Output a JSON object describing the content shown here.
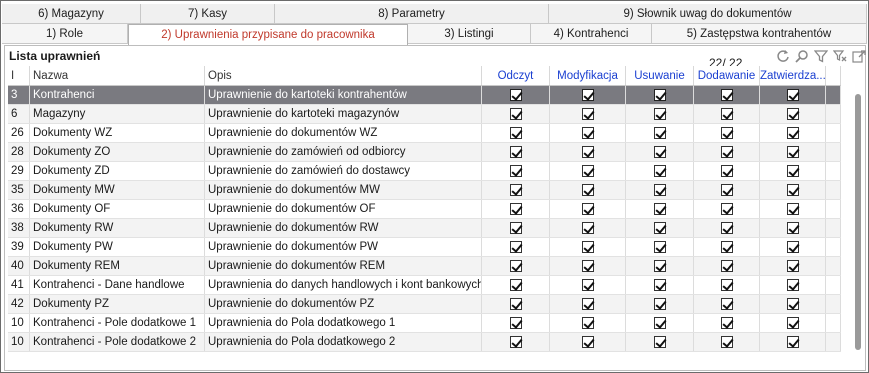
{
  "tabs_row1": [
    {
      "label": "6) Magazyny",
      "active": false
    },
    {
      "label": "7) Kasy",
      "active": false
    },
    {
      "label": "8) Parametry",
      "active": false
    },
    {
      "label": "9) Słownik uwag do dokumentów",
      "active": false
    }
  ],
  "tabs_row2": [
    {
      "label": "1) Role",
      "active": false
    },
    {
      "label": "2) Uprawnienia przypisane do pracownika",
      "active": true
    },
    {
      "label": "3) Listingi",
      "active": false
    },
    {
      "label": "4) Kontrahenci",
      "active": false
    },
    {
      "label": "5) Zastępstwa kontrahentów",
      "active": false
    }
  ],
  "panel": {
    "title": "Lista uprawnień",
    "counter": "22/ 22"
  },
  "toolbar_icons": [
    "refresh-icon",
    "search-icon",
    "filter-icon",
    "clear-filter-icon",
    "export-icon"
  ],
  "columns": {
    "id": "I",
    "name": "Nazwa",
    "desc": "Opis",
    "read": "Odczyt",
    "modify": "Modyfikacja",
    "delete": "Usuwanie",
    "add": "Dodawanie",
    "approve": "Zatwierdza..."
  },
  "rows": [
    {
      "id": "3",
      "name": "Kontrahenci",
      "desc": "Uprawnienie do kartoteki kontrahentów",
      "checked": [
        true,
        true,
        true,
        true,
        true
      ],
      "selected": true
    },
    {
      "id": "6",
      "name": "Magazyny",
      "desc": "Uprawnienie do kartoteki magazynów",
      "checked": [
        true,
        true,
        true,
        true,
        true
      ],
      "selected": false
    },
    {
      "id": "26",
      "name": "Dokumenty WZ",
      "desc": "Uprawnienie do dokumentów WZ",
      "checked": [
        true,
        true,
        true,
        true,
        true
      ],
      "selected": false
    },
    {
      "id": "28",
      "name": "Dokumenty ZO",
      "desc": "Uprawnienie do zamówień od odbiorcy",
      "checked": [
        true,
        true,
        true,
        true,
        true
      ],
      "selected": false
    },
    {
      "id": "29",
      "name": "Dokumenty ZD",
      "desc": "Uprawnienie do zamówień do dostawcy",
      "checked": [
        true,
        true,
        true,
        true,
        true
      ],
      "selected": false
    },
    {
      "id": "35",
      "name": "Dokumenty MW",
      "desc": "Uprawnienie do dokumentów MW",
      "checked": [
        true,
        true,
        true,
        true,
        true
      ],
      "selected": false
    },
    {
      "id": "36",
      "name": "Dokumenty OF",
      "desc": "Uprawnienie do dokumentów OF",
      "checked": [
        true,
        true,
        true,
        true,
        true
      ],
      "selected": false
    },
    {
      "id": "38",
      "name": "Dokumenty RW",
      "desc": "Uprawnienie do dokumentów RW",
      "checked": [
        true,
        true,
        true,
        true,
        true
      ],
      "selected": false
    },
    {
      "id": "39",
      "name": "Dokumenty PW",
      "desc": "Uprawnienie do dokumentów PW",
      "checked": [
        true,
        true,
        true,
        true,
        true
      ],
      "selected": false
    },
    {
      "id": "40",
      "name": "Dokumenty REM",
      "desc": "Uprawnienie do dokumentów REM",
      "checked": [
        true,
        true,
        true,
        true,
        true
      ],
      "selected": false
    },
    {
      "id": "41",
      "name": "Kontrahenci - Dane handlowe",
      "desc": "Uprawnienia do danych handlowych i kont bankowych",
      "checked": [
        true,
        true,
        true,
        true,
        true
      ],
      "selected": false
    },
    {
      "id": "42",
      "name": "Dokumenty PZ",
      "desc": "Uprawnienie do dokumentów PZ",
      "checked": [
        true,
        true,
        true,
        true,
        true
      ],
      "selected": false
    },
    {
      "id": "10",
      "name": "Kontrahenci - Pole dodatkowe 1",
      "desc": "Uprawnienia do Pola dodatkowego 1",
      "checked": [
        true,
        true,
        true,
        true,
        true
      ],
      "selected": false
    },
    {
      "id": "10",
      "name": "Kontrahenci - Pole dodatkowe 2",
      "desc": "Uprawnienia do Pola dodatkowego 2",
      "checked": [
        true,
        true,
        true,
        true,
        true
      ],
      "selected": false
    }
  ],
  "colors": {
    "active_tab_text": "#c0392b",
    "header_blue": "#1a3fd1",
    "selected_row": "#7a7a80"
  }
}
